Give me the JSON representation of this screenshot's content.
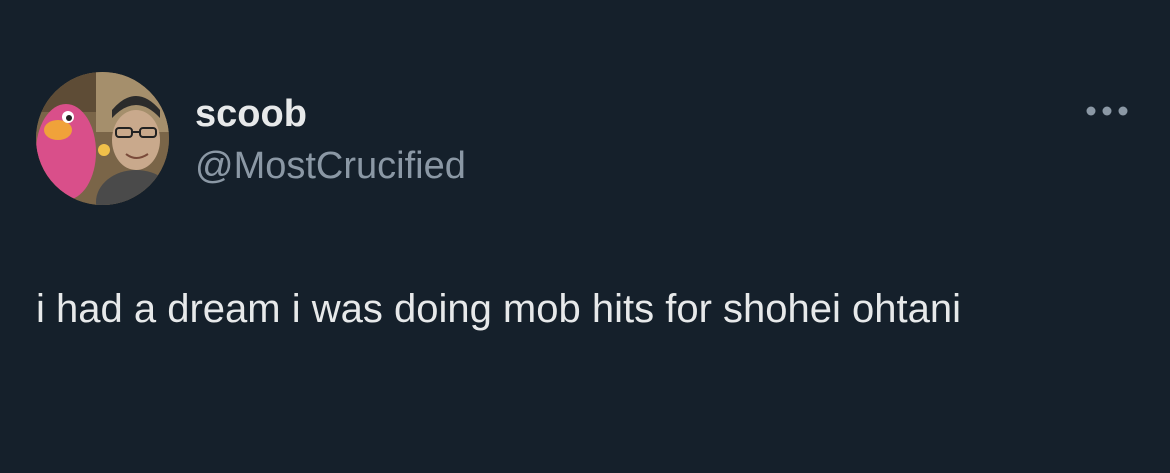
{
  "tweet": {
    "author": {
      "display_name": "scoob",
      "handle": "@MostCrucified",
      "avatar_icon": "profile-photo"
    },
    "more_icon": "ellipsis-icon",
    "text": "i had a dream i was doing mob hits for shohei ohtani"
  },
  "colors": {
    "background": "#15202b",
    "primary_text": "#e7e9ea",
    "secondary_text": "#8b98a5"
  }
}
